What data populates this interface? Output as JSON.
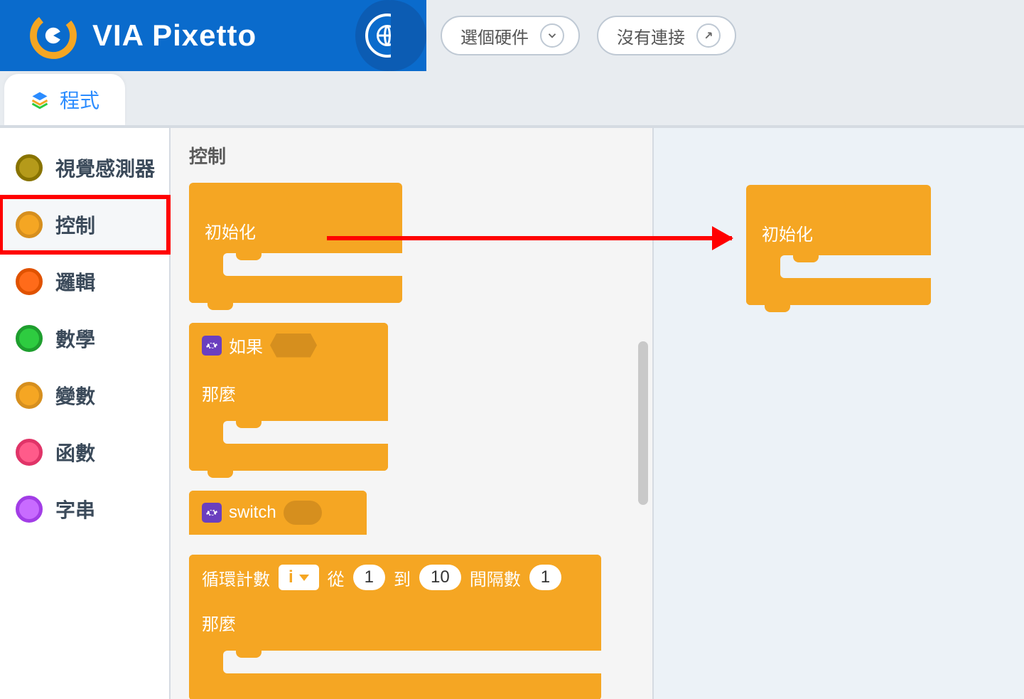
{
  "header": {
    "brand": "VIA Pixetto",
    "hardware_label": "選個硬件",
    "connection_label": "沒有連接"
  },
  "tab": {
    "label": "程式"
  },
  "categories": [
    {
      "id": "vision",
      "label": "視覺感測器",
      "color": "#b59a1a",
      "ring": "#887300"
    },
    {
      "id": "control",
      "label": "控制",
      "color": "#f5a623",
      "ring": "#d68f1e",
      "selected": true
    },
    {
      "id": "logic",
      "label": "邏輯",
      "color": "#ff6b1a",
      "ring": "#e05200"
    },
    {
      "id": "math",
      "label": "數學",
      "color": "#2ecc40",
      "ring": "#1e9e2e"
    },
    {
      "id": "variable",
      "label": "變數",
      "color": "#f5a623",
      "ring": "#d68f1e"
    },
    {
      "id": "function",
      "label": "函數",
      "color": "#ff5b8a",
      "ring": "#e03468"
    },
    {
      "id": "string",
      "label": "字串",
      "color": "#c86bff",
      "ring": "#a23de6"
    }
  ],
  "palette": {
    "title": "控制",
    "blocks": {
      "init": "初始化",
      "if": "如果",
      "then": "那麼",
      "switch": "switch",
      "loop_count": "循環計數",
      "loop_var": "i",
      "from": "從",
      "from_val": "1",
      "to": "到",
      "to_val": "10",
      "step": "間隔數",
      "step_val": "1"
    }
  },
  "canvas": {
    "init": "初始化"
  }
}
